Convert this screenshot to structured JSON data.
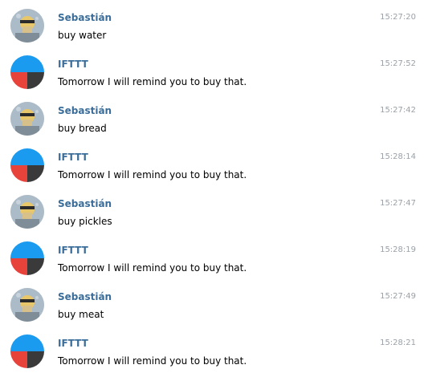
{
  "messages": [
    {
      "sender": "Sebastián",
      "time": "15:27:20",
      "text": "buy water",
      "avatar": "user-photo"
    },
    {
      "sender": "IFTTT",
      "time": "15:27:52",
      "text": "Tomorrow I will remind you to buy that.",
      "avatar": "ifttt-logo"
    },
    {
      "sender": "Sebastián",
      "time": "15:27:42",
      "text": "buy bread",
      "avatar": "user-photo"
    },
    {
      "sender": "IFTTT",
      "time": "15:28:14",
      "text": "Tomorrow I will remind you to buy that.",
      "avatar": "ifttt-logo"
    },
    {
      "sender": "Sebastián",
      "time": "15:27:47",
      "text": "buy pickles",
      "avatar": "user-photo"
    },
    {
      "sender": "IFTTT",
      "time": "15:28:19",
      "text": "Tomorrow I will remind you to buy that.",
      "avatar": "ifttt-logo"
    },
    {
      "sender": "Sebastián",
      "time": "15:27:49",
      "text": "buy meat",
      "avatar": "user-photo"
    },
    {
      "sender": "IFTTT",
      "time": "15:28:21",
      "text": "Tomorrow I will remind you to buy that.",
      "avatar": "ifttt-logo"
    }
  ],
  "colors": {
    "sender_name": "#3a6d99",
    "timestamp": "#9aa1a8",
    "ifttt_blue": "#1a9bf0",
    "ifttt_red": "#e8433a",
    "ifttt_dark": "#3a3a3a"
  }
}
